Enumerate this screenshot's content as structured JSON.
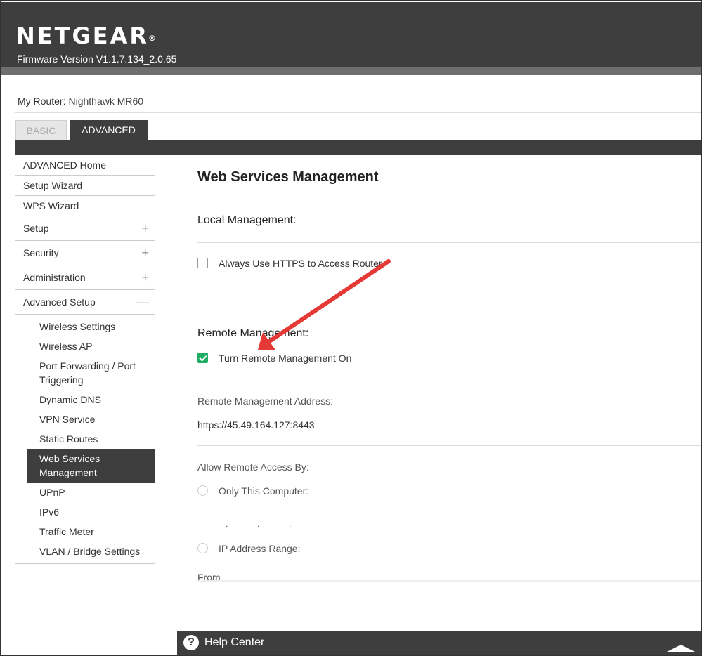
{
  "header": {
    "brand": "NETGEAR",
    "trademark": "®",
    "firmware_label": "Firmware Version",
    "firmware_version": "V1.1.7.134_2.0.65"
  },
  "router": {
    "label": "My Router:",
    "name": "Nighthawk MR60"
  },
  "tabs": [
    {
      "label": "BASIC",
      "active": false
    },
    {
      "label": "ADVANCED",
      "active": true
    }
  ],
  "sidebar": {
    "items": [
      {
        "label": "ADVANCED Home"
      },
      {
        "label": "Setup Wizard"
      },
      {
        "label": "WPS Wizard"
      },
      {
        "label": "Setup",
        "toggle": "+"
      },
      {
        "label": "Security",
        "toggle": "+"
      },
      {
        "label": "Administration",
        "toggle": "+"
      },
      {
        "label": "Advanced Setup",
        "toggle": "—"
      }
    ],
    "subitems": [
      {
        "label": "Wireless Settings"
      },
      {
        "label": "Wireless AP"
      },
      {
        "label": "Port Forwarding / Port Triggering"
      },
      {
        "label": "Dynamic DNS"
      },
      {
        "label": "VPN Service"
      },
      {
        "label": "Static Routes"
      },
      {
        "label": "Web Services Management",
        "active": true
      },
      {
        "label": "UPnP"
      },
      {
        "label": "IPv6"
      },
      {
        "label": "Traffic Meter"
      },
      {
        "label": "VLAN / Bridge Settings"
      }
    ]
  },
  "main": {
    "title": "Web Services Management",
    "local_management": {
      "heading": "Local Management:",
      "https_label": "Always Use HTTPS to Access Router",
      "https_checked": false
    },
    "remote_management": {
      "heading": "Remote Management:",
      "turn_on_label": "Turn Remote Management On",
      "turn_on_checked": true,
      "address_label": "Remote Management Address:",
      "address_value": "https://45.49.164.127:8443",
      "allow_label": "Allow Remote Access By:",
      "only_this_computer": "Only This Computer:",
      "ip_range": "IP Address Range:",
      "from_label": "From"
    }
  },
  "help": {
    "icon": "?",
    "label": "Help Center"
  },
  "colors": {
    "header_bg": "#3e3e3e",
    "check_green": "#1fae64",
    "annotation_red": "#e53935"
  }
}
